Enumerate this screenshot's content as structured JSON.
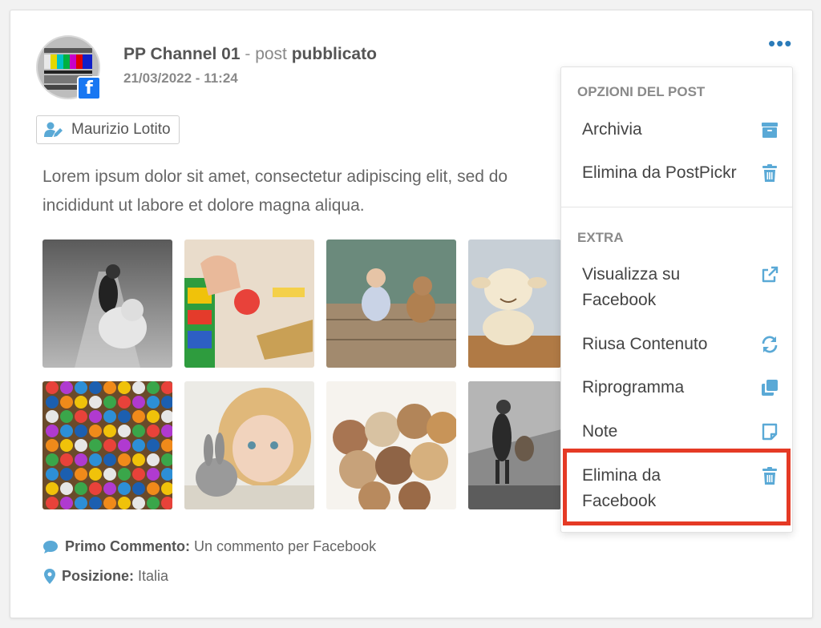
{
  "post": {
    "channel_name": "PP Channel 01",
    "separator": " - ",
    "post_word": "post",
    "status": "pubblicato",
    "date": "21/03/2022 - 11:24",
    "author": "Maurizio Lotito",
    "text_line1": "Lorem ipsum dolor sit amet, consectetur adipiscing elit, sed do",
    "text_line2": "incididunt ut labore et dolore magna aliqua.",
    "first_comment_label": "Primo Commento:",
    "first_comment_value": "Un commento per Facebook",
    "location_label": "Posizione:",
    "location_value": "Italia"
  },
  "menu": {
    "header_options": "OPZIONI DEL POST",
    "header_extra": "EXTRA",
    "items": [
      {
        "label": "Archivia",
        "icon": "archive-icon"
      },
      {
        "label": "Elimina da PostPickr",
        "icon": "trash-icon"
      },
      {
        "label_line1": "Visualizza su",
        "label_line2": "Facebook",
        "icon": "external-link-icon"
      },
      {
        "label": "Riusa Contenuto",
        "icon": "sync-icon"
      },
      {
        "label": "Riprogramma",
        "icon": "clone-icon"
      },
      {
        "label": "Note",
        "icon": "sticky-note-icon"
      },
      {
        "label_line1": "Elimina da",
        "label_line2": "Facebook",
        "icon": "trash-icon"
      }
    ]
  },
  "colors": {
    "accent": "#5aa9d6",
    "link_blue": "#2b7bb9",
    "highlight": "#e53a25",
    "facebook": "#1877f2"
  },
  "photos": [
    "girl-with-teddy-bw",
    "toy-blocks",
    "child-and-teddy-on-dock",
    "sheep-plush",
    "marbles",
    "girl-with-bunny",
    "pile-of-teddy-bears",
    "girl-with-teddy-bw-2"
  ]
}
